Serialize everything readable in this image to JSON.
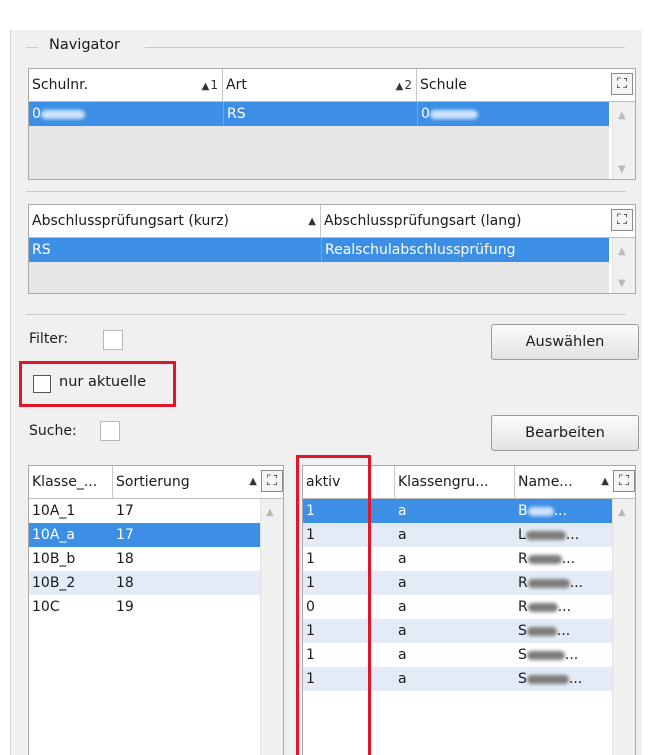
{
  "navigator": {
    "title": "Navigator",
    "schools": {
      "columns": [
        {
          "label": "Schulnr.",
          "sort": "1"
        },
        {
          "label": "Art",
          "sort": "2"
        },
        {
          "label": "Schule",
          "sort": ""
        }
      ],
      "rows": [
        {
          "schulnr": "0",
          "art": "RS",
          "schule": "0",
          "selected": true
        }
      ]
    },
    "exam_types": {
      "columns": [
        {
          "label": "Abschlussprüfungsart (kurz)",
          "sort": ""
        },
        {
          "label": "Abschlussprüfungsart (lang)",
          "sort": ""
        }
      ],
      "rows": [
        {
          "kurz": "RS",
          "lang": "Realschulabschlussprüfung",
          "selected": true
        }
      ]
    }
  },
  "filter": {
    "label": "Filter:",
    "checked": false
  },
  "only_current": {
    "label": "nur aktuelle",
    "checked": false
  },
  "search": {
    "label": "Suche:",
    "checked": false
  },
  "buttons": {
    "select": "Auswählen",
    "edit": "Bearbeiten"
  },
  "classes": {
    "columns": [
      "Klasse_...",
      "Sortierung"
    ],
    "rows": [
      {
        "klasse": "10A_1",
        "sortierung": "17"
      },
      {
        "klasse": "10A_a",
        "sortierung": "17",
        "selected": true
      },
      {
        "klasse": "10B_b",
        "sortierung": "18"
      },
      {
        "klasse": "10B_2",
        "sortierung": "18"
      },
      {
        "klasse": "10C",
        "sortierung": "19"
      }
    ]
  },
  "students": {
    "columns": [
      "aktiv",
      "Klassengru...",
      "Name..."
    ],
    "rows": [
      {
        "aktiv": "1",
        "gruppe": "a",
        "name_initial": "B",
        "ellipsis": "...",
        "selected": true
      },
      {
        "aktiv": "1",
        "gruppe": "a",
        "name_initial": "L",
        "ellipsis": "..."
      },
      {
        "aktiv": "1",
        "gruppe": "a",
        "name_initial": "R",
        "ellipsis": "..."
      },
      {
        "aktiv": "1",
        "gruppe": "a",
        "name_initial": "R",
        "ellipsis": "..."
      },
      {
        "aktiv": "0",
        "gruppe": "a",
        "name_initial": "R",
        "ellipsis": "..."
      },
      {
        "aktiv": "1",
        "gruppe": "a",
        "name_initial": "S",
        "ellipsis": "..."
      },
      {
        "aktiv": "1",
        "gruppe": "a",
        "name_initial": "S",
        "ellipsis": "..."
      },
      {
        "aktiv": "1",
        "gruppe": "a",
        "name_initial": "S",
        "ellipsis": "..."
      }
    ]
  },
  "colors": {
    "selection": "#3c8fe4",
    "alt_row": "#e3ebf7",
    "highlight": "#e0162b"
  }
}
